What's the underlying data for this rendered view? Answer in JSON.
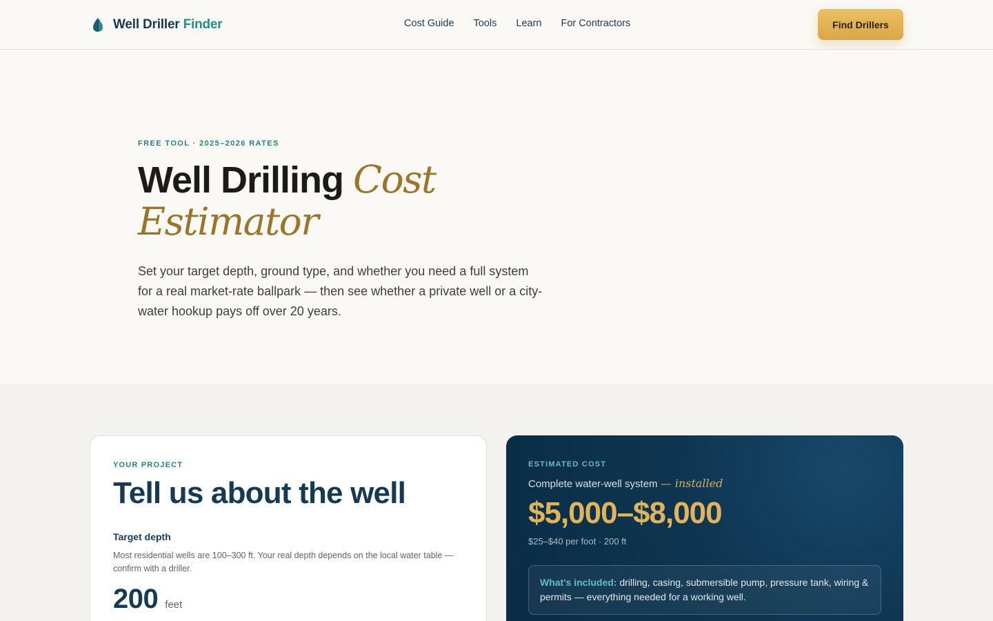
{
  "header": {
    "brand_main": "Well Driller",
    "brand_accent": "Finder",
    "nav": [
      "Cost Guide",
      "Tools",
      "Learn",
      "For Contractors"
    ],
    "cta_label": "Find Drillers"
  },
  "hero": {
    "eyebrow": "FREE TOOL · 2025–2026 RATES",
    "title_plain": "Well Drilling",
    "title_serif": "Cost Estimator",
    "subtitle": "Set your target depth, ground type, and whether you need a full system for a real market-rate ballpark — then see whether a private well or a city-water hookup pays off over 20 years."
  },
  "form": {
    "section_label": "YOUR PROJECT",
    "title": "Tell us about the well",
    "depth_label": "Target depth",
    "depth_help": "Most residential wells are 100–300 ft. Your real depth depends on the local water table — confirm with a driller.",
    "depth_value": "200",
    "depth_unit": "feet"
  },
  "estimate": {
    "section_label": "ESTIMATED COST",
    "system_text": "Complete water-well system",
    "system_serif": "— installed",
    "range": "$5,000–$8,000",
    "meta": "$25–$40 per foot · 200 ft",
    "included_label": "What's included:",
    "included_text": "drilling, casing, submersible pump, pressure tank, wiring & permits — everything needed for a working well."
  },
  "colors": {
    "brand_navy": "#163a52",
    "brand_teal": "#2a8a88",
    "gold": "#d9a645",
    "estimate_bg": "#0e3550"
  },
  "icons": {
    "logo": "water-drop-leaf-icon"
  }
}
